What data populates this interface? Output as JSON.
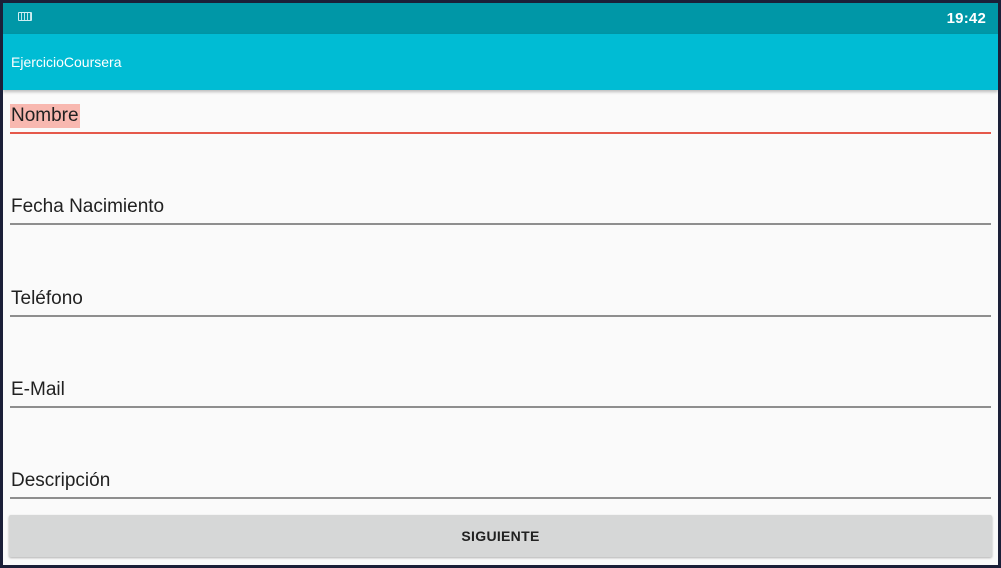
{
  "status_bar": {
    "icon": "keyboard-icon",
    "time": "19:42"
  },
  "app_bar": {
    "title": "EjercicioCoursera"
  },
  "form": {
    "fields": [
      {
        "label": "Nombre",
        "focused": true
      },
      {
        "label": "Fecha Nacimiento",
        "focused": false
      },
      {
        "label": "Teléfono",
        "focused": false
      },
      {
        "label": "E-Mail",
        "focused": false
      },
      {
        "label": "Descripción",
        "focused": false
      }
    ]
  },
  "actions": {
    "next_label": "SIGUIENTE"
  },
  "colors": {
    "status_bar": "#0097a7",
    "app_bar": "#00bcd4",
    "focus_underline": "#e5584a",
    "focus_highlight": "#f8b8b0"
  }
}
